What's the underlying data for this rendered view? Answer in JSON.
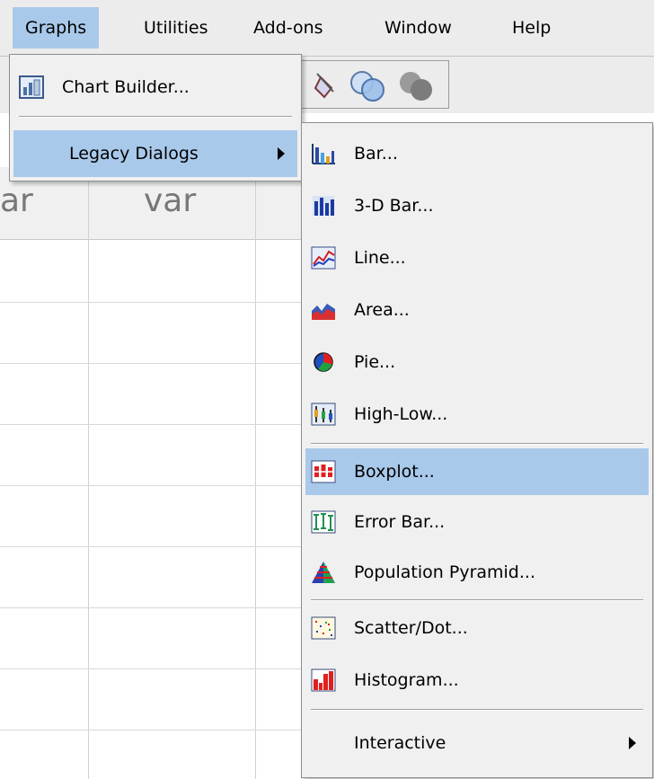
{
  "menubar": {
    "items": [
      {
        "label": "Graphs",
        "mnemonic": "G",
        "active": true
      },
      {
        "label": "Utilities",
        "mnemonic": "U"
      },
      {
        "label": "Add-ons",
        "mnemonic": "o"
      },
      {
        "label": "Window",
        "mnemonic": "W"
      },
      {
        "label": "Help",
        "mnemonic": "H"
      }
    ]
  },
  "spreadsheet": {
    "column_headers": [
      "ar",
      "var"
    ]
  },
  "graphs_menu": {
    "items": [
      {
        "label": "Chart Builder...",
        "icon": "chart-builder-icon"
      },
      {
        "label": "Legacy Dialogs",
        "has_submenu": true,
        "highlighted": true
      }
    ]
  },
  "legacy_menu": {
    "items": [
      {
        "label": "Bar...",
        "icon": "bar-chart-icon"
      },
      {
        "label": "3-D Bar...",
        "icon": "3d-bar-chart-icon"
      },
      {
        "label": "Line...",
        "icon": "line-chart-icon"
      },
      {
        "label": "Area...",
        "icon": "area-chart-icon"
      },
      {
        "label": "Pie...",
        "icon": "pie-chart-icon"
      },
      {
        "label": "High-Low...",
        "icon": "high-low-chart-icon"
      },
      {
        "label": "Boxplot...",
        "icon": "boxplot-icon",
        "highlighted": true
      },
      {
        "label": "Error Bar...",
        "icon": "error-bar-icon"
      },
      {
        "label": "Population Pyramid...",
        "icon": "population-pyramid-icon"
      },
      {
        "label": "Scatter/Dot...",
        "icon": "scatter-dot-icon"
      },
      {
        "label": "Histogram...",
        "icon": "histogram-icon"
      },
      {
        "label": "Interactive",
        "has_submenu": true
      }
    ]
  },
  "colors": {
    "highlight": "#a9c9ea",
    "menu_bg": "#f0f0f0"
  }
}
